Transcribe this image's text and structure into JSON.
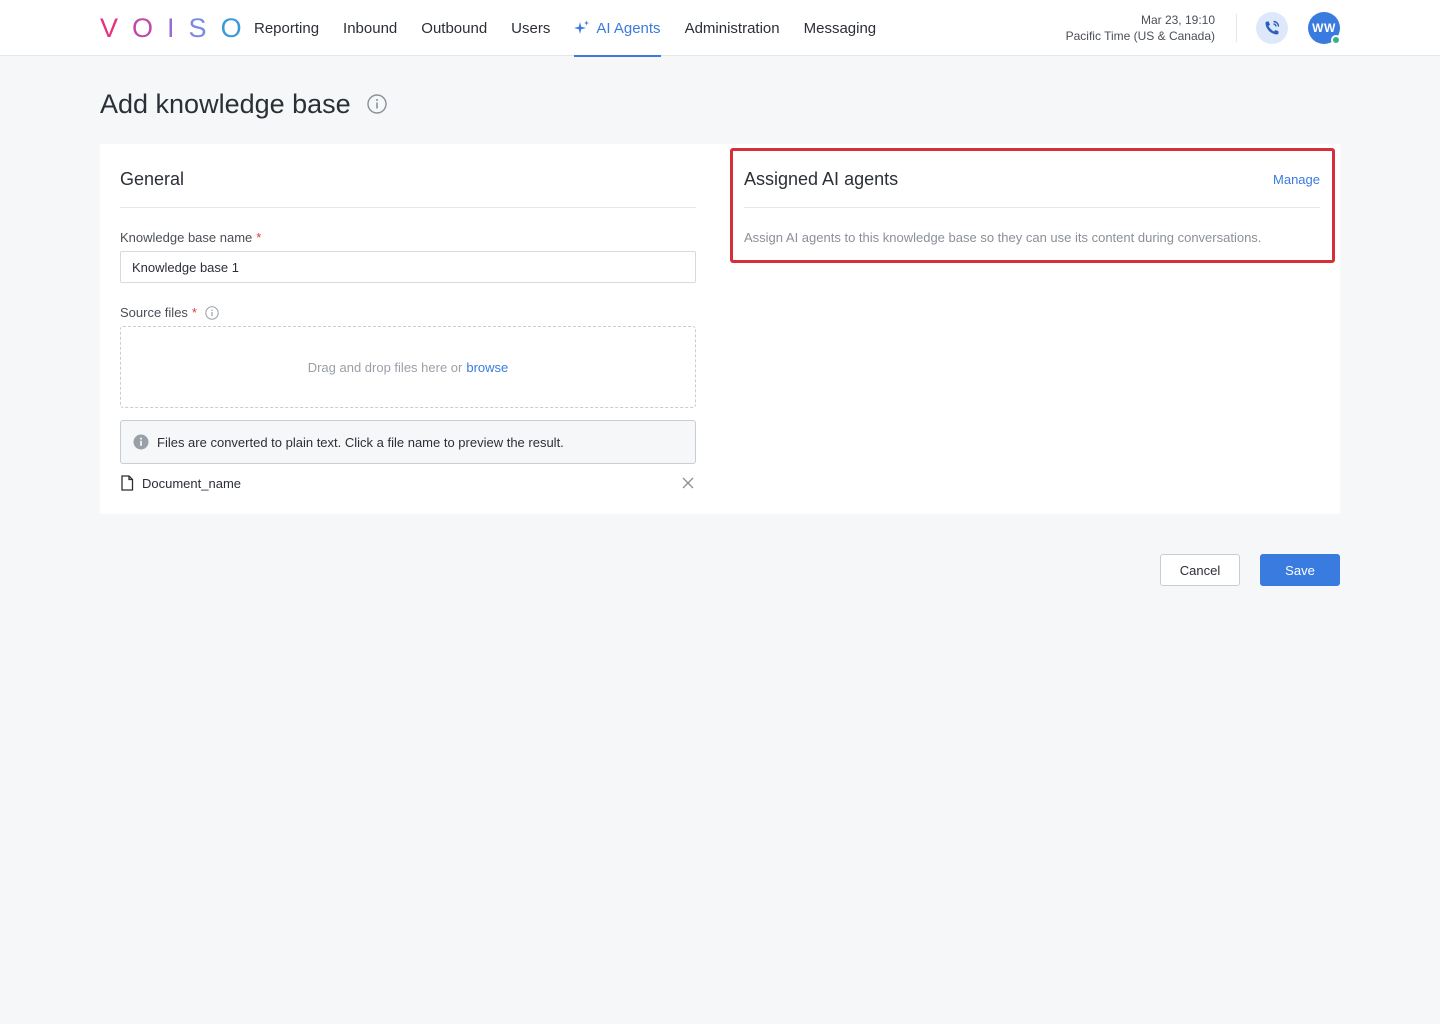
{
  "brand": {
    "letters": [
      "V",
      "O",
      "I",
      "S",
      "O"
    ],
    "colors": [
      "#e8327c",
      "#c04aa8",
      "#9a6ad0",
      "#7a8ae0",
      "#3a9ad8"
    ]
  },
  "nav": {
    "items": [
      {
        "label": "Reporting",
        "active": false
      },
      {
        "label": "Inbound",
        "active": false
      },
      {
        "label": "Outbound",
        "active": false
      },
      {
        "label": "Users",
        "active": false
      },
      {
        "label": "AI Agents",
        "active": true
      },
      {
        "label": "Administration",
        "active": false
      },
      {
        "label": "Messaging",
        "active": false
      }
    ]
  },
  "header": {
    "date": "Mar 23, 19:10",
    "timezone": "Pacific Time (US & Canada)",
    "avatar_initials": "WW"
  },
  "page": {
    "title": "Add knowledge base"
  },
  "general": {
    "title": "General",
    "name_label": "Knowledge base name",
    "required_mark": "*",
    "name_value": "Knowledge base 1",
    "source_label": "Source files",
    "dropzone_text": "Drag and drop files here or",
    "browse_link": "browse",
    "notice_text": "Files are converted to plain text. Click a file name to preview the result.",
    "files": [
      {
        "name": "Document_name"
      }
    ]
  },
  "assigned": {
    "title": "Assigned AI agents",
    "manage_link": "Manage",
    "description": "Assign AI agents to this knowledge base so they can use its content during conversations."
  },
  "actions": {
    "cancel_label": "Cancel",
    "save_label": "Save"
  },
  "colors": {
    "accent": "#3a7be0",
    "required": "#e03a3a",
    "highlight": "#d62e3a",
    "online": "#36b37e"
  }
}
